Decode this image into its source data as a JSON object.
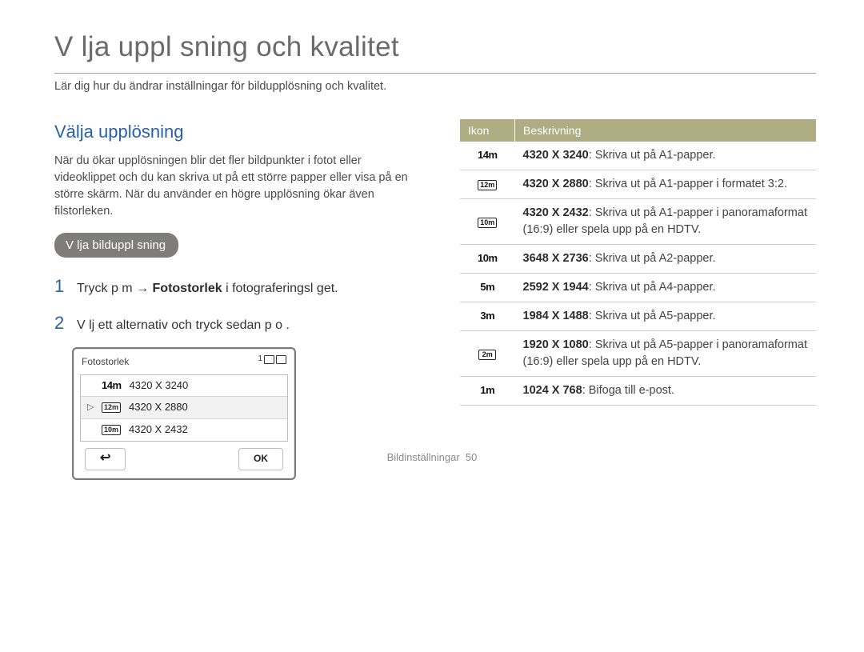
{
  "header": {
    "title": "V lja uppl sning och kvalitet",
    "subtitle": "Lär dig hur du ändrar inställningar för bildupplösning och kvalitet."
  },
  "left": {
    "heading": "Välja upplösning",
    "body": "När du ökar upplösningen blir det fler bildpunkter i fotot eller videoklippet och du kan skriva ut på ett större papper eller visa på en större skärm. När du använder en högre upplösning ökar även filstorleken.",
    "pill": "V lja bilduppl sning",
    "steps": [
      {
        "num": "1",
        "pre": "Tryck p  m   → ",
        "bold": "Fotostorlek",
        "post": " i fotograferingsl get."
      },
      {
        "num": "2",
        "pre": "V lj ett alternativ och tryck sedan p  o  .",
        "bold": "",
        "post": ""
      }
    ],
    "device": {
      "title": "Fotostorlek",
      "status_count": "1",
      "options": [
        {
          "icon": "14m",
          "label": "4320 X 3240",
          "selected": false
        },
        {
          "icon": "12m",
          "label": "4320 X 2880",
          "selected": true
        },
        {
          "icon": "10m",
          "label": "4320 X 2432",
          "selected": false
        }
      ],
      "ok": "OK"
    }
  },
  "right": {
    "th_icon": "Ikon",
    "th_desc": "Beskrivning",
    "rows": [
      {
        "icon_type": "plain",
        "icon": "14m",
        "dim": "4320 X 3240",
        "desc": ": Skriva ut på A1-papper."
      },
      {
        "icon_type": "box",
        "icon": "12m",
        "dim": "4320 X 2880",
        "desc": ": Skriva ut på A1-papper i formatet 3:2."
      },
      {
        "icon_type": "box",
        "icon": "10m",
        "dim": "4320 X 2432",
        "desc": ": Skriva ut på A1-papper i panoramaformat (16:9) eller spela upp på en HDTV."
      },
      {
        "icon_type": "plain",
        "icon": "10m",
        "dim": "3648 X 2736",
        "desc": ": Skriva ut på A2-papper."
      },
      {
        "icon_type": "plain",
        "icon": "5m",
        "dim": "2592 X 1944",
        "desc": ": Skriva ut på A4-papper."
      },
      {
        "icon_type": "plain",
        "icon": "3m",
        "dim": "1984 X 1488",
        "desc": ": Skriva ut på A5-papper."
      },
      {
        "icon_type": "box",
        "icon": "2m",
        "dim": "1920 X 1080",
        "desc": ": Skriva ut på A5-papper i panoramaformat (16:9) eller spela upp på en HDTV."
      },
      {
        "icon_type": "plain",
        "icon": "1m",
        "dim": "1024 X 768",
        "desc": ": Bifoga till e-post."
      }
    ]
  },
  "footer": {
    "section": "Bildinställningar",
    "page": "50"
  }
}
